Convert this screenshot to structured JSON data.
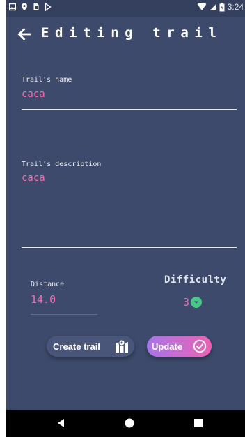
{
  "status_bar": {
    "time": "3:24",
    "left_icons": [
      "image-icon",
      "location-icon",
      "sim-icon",
      "play-store-icon"
    ],
    "right_icons": [
      "wifi-icon",
      "signal-icon",
      "battery-icon"
    ]
  },
  "app_bar": {
    "title": "Editing trail",
    "back_icon": "arrow-left-icon"
  },
  "form": {
    "name": {
      "label": "Trail's name",
      "value": "caca"
    },
    "description": {
      "label": "Trail's description",
      "value": "caca"
    },
    "distance": {
      "label": "Distance",
      "value": "14.0"
    },
    "difficulty": {
      "label": "Difficulty",
      "value": "3"
    }
  },
  "buttons": {
    "create_trail": {
      "label": "Create trail",
      "icon": "map-icon"
    },
    "update": {
      "label": "Update",
      "icon": "check-circle-icon"
    }
  },
  "colors": {
    "background": "#3d4a6b",
    "value_text": "#f06fb0",
    "accent_green": "#48c98a",
    "update_gradient_start": "#a874e8",
    "update_gradient_end": "#ea62b4"
  },
  "nav_bar": {
    "items": [
      "back-triangle-icon",
      "home-circle-icon",
      "recents-square-icon"
    ]
  }
}
